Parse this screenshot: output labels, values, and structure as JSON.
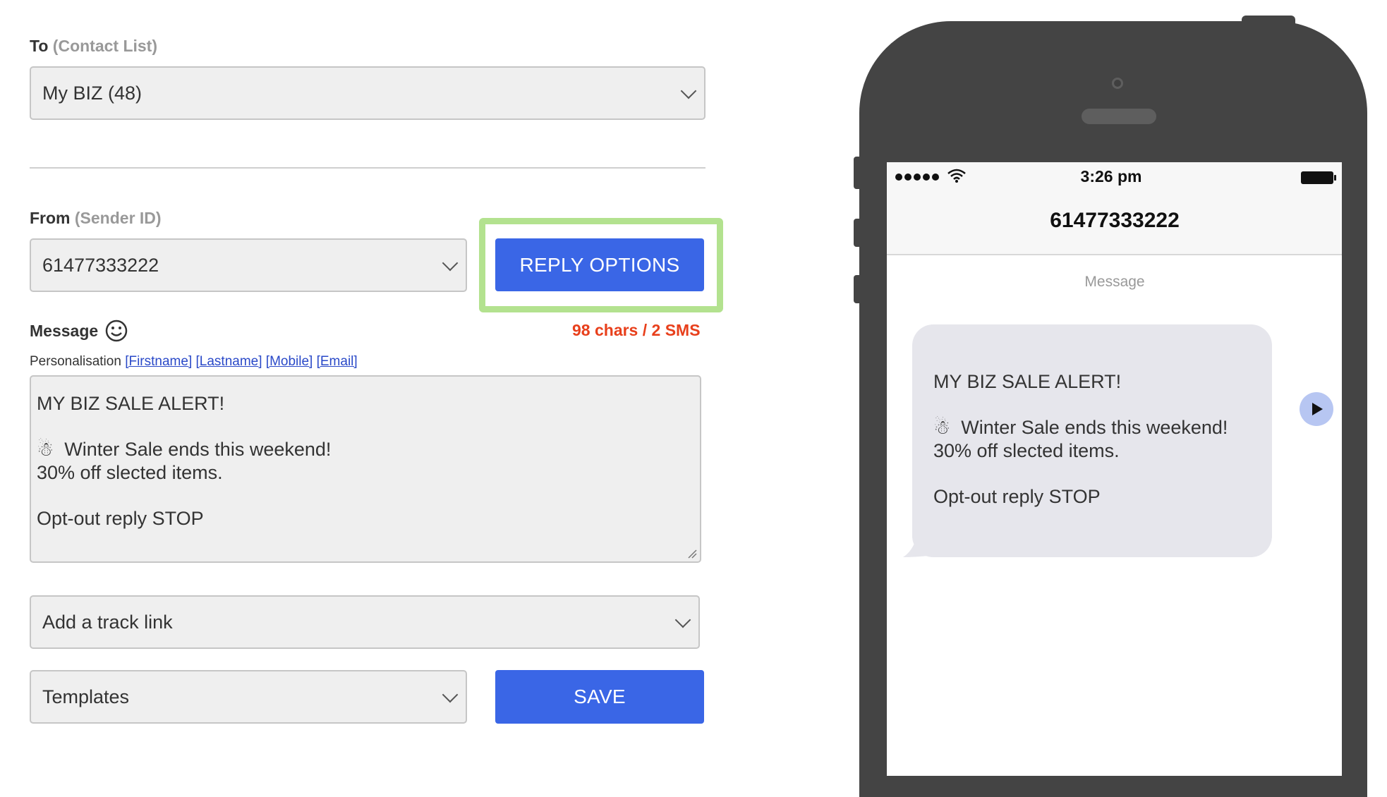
{
  "to": {
    "label": "To",
    "sub": "(Contact List)",
    "selected": "My BIZ (48)"
  },
  "from": {
    "label": "From",
    "sub": "(Sender ID)",
    "selected": "61477333222"
  },
  "reply_options": {
    "label": "REPLY OPTIONS"
  },
  "message": {
    "label": "Message",
    "counter": "98 chars / 2 SMS",
    "personalisation_label": "Personalisation",
    "tags": [
      "[Firstname]",
      "[Lastname]",
      "[Mobile]",
      "[Email]"
    ],
    "line1": "MY BIZ SALE ALERT!",
    "line2": "☃  Winter Sale ends this weekend!",
    "line3": "30% off slected items.",
    "line4": "Opt-out reply STOP"
  },
  "track_link": {
    "selected": "Add a track link"
  },
  "templates": {
    "selected": "Templates"
  },
  "save": {
    "label": "SAVE"
  },
  "phone": {
    "time": "3:26 pm",
    "contact": "61477333222",
    "message_header": "Message",
    "bubble_line1": "MY BIZ SALE ALERT!",
    "bubble_line2": "☃  Winter Sale ends this weekend!",
    "bubble_line3": "30% off slected items.",
    "bubble_line4": "Opt-out reply STOP"
  },
  "colors": {
    "primary": "#3a66e6",
    "highlight": "#b3e28f",
    "counter": "#e8401c",
    "phone_body": "#444444"
  },
  "icons": [
    "smiley-icon",
    "chevron-down-icon",
    "signal-dots-icon",
    "wifi-icon",
    "battery-icon",
    "play-icon",
    "snowman-icon"
  ]
}
